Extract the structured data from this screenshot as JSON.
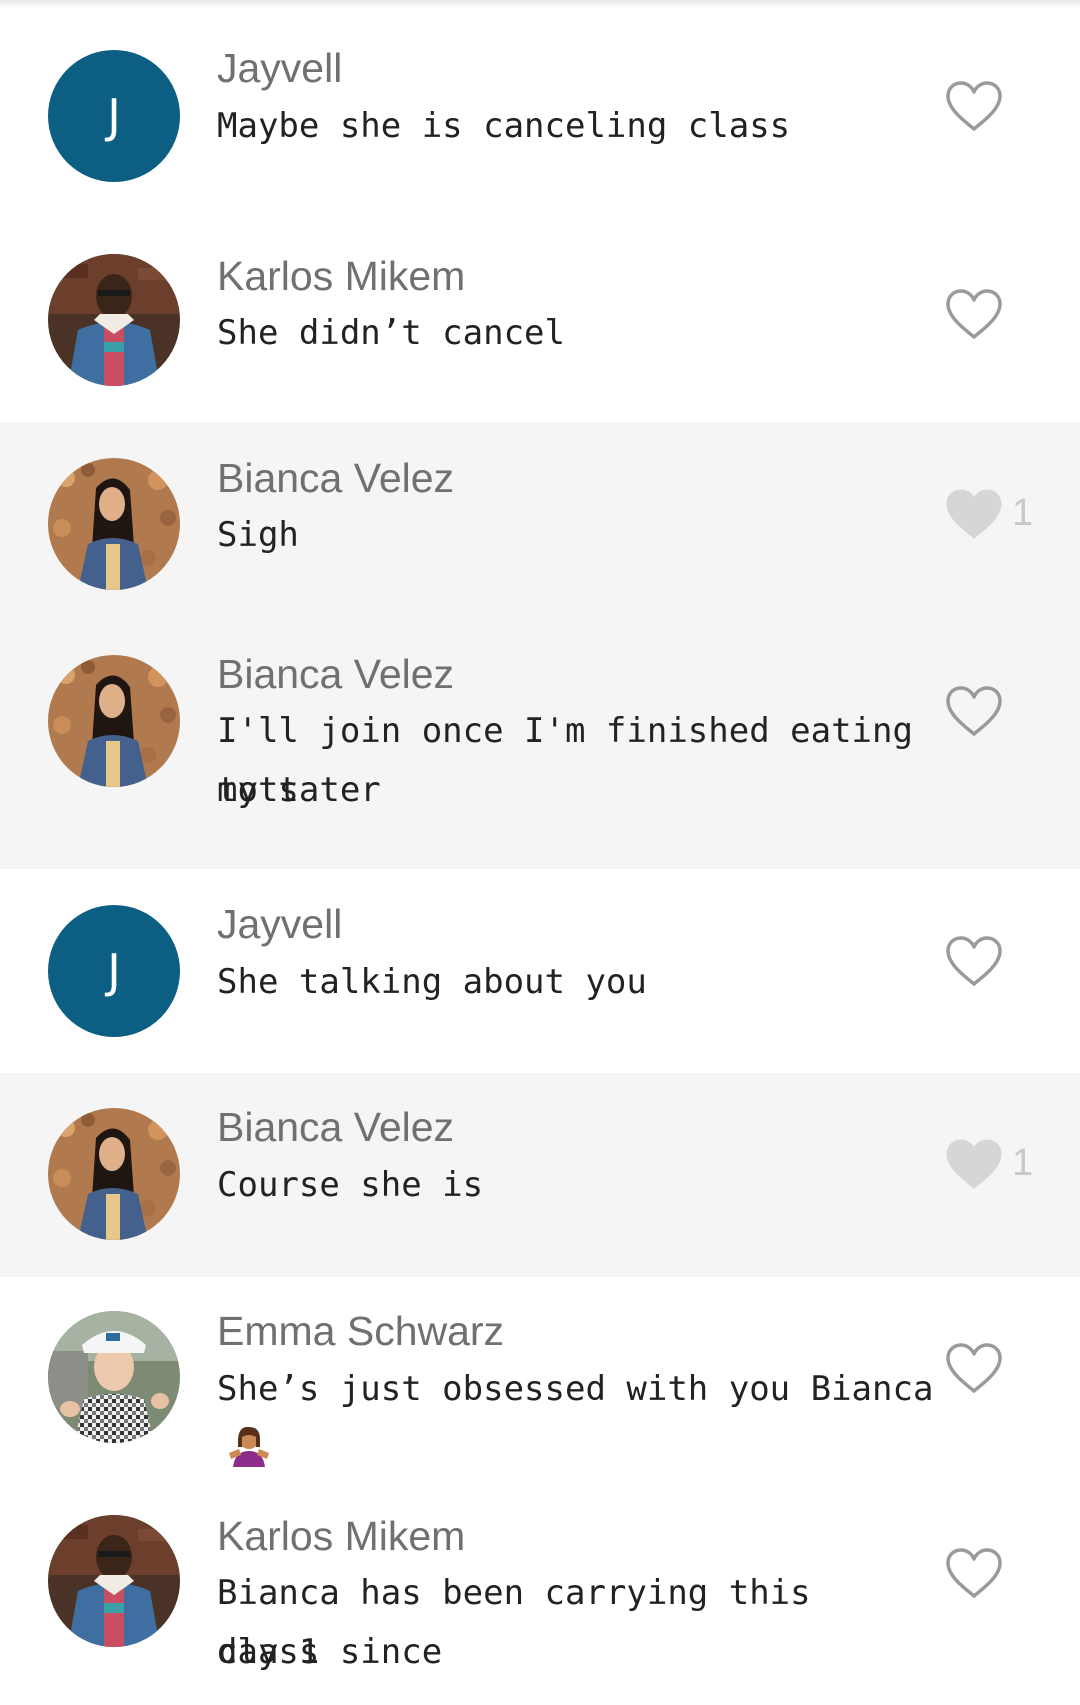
{
  "messages": [
    {
      "author": "Jayvell",
      "avatar_initial": "J",
      "text": "Maybe she is canceling class",
      "liked": false,
      "like_count": null
    },
    {
      "author": "Karlos Mikem",
      "text": "She didn’t cancel",
      "liked": false,
      "like_count": null
    },
    {
      "author": "Bianca Velez",
      "text": "Sigh",
      "liked": true,
      "like_count": "1"
    },
    {
      "author": "Bianca Velez",
      "text_line1": "I'll join once I'm finished eating my tater",
      "text_line2": "tots",
      "liked": false,
      "like_count": null
    },
    {
      "author": "Jayvell",
      "avatar_initial": "J",
      "text": "She talking about you",
      "liked": false,
      "like_count": null
    },
    {
      "author": "Bianca Velez",
      "text": "Course she is",
      "liked": true,
      "like_count": "1"
    },
    {
      "author": "Emma Schwarz",
      "text": "She’s just obsessed with you Bianca",
      "emoji": "person-shrugging-emoji",
      "liked": false,
      "like_count": null
    },
    {
      "author": "Karlos Mikem",
      "text_line1": "Bianca has been carrying this class since",
      "text_line2": "day 1",
      "liked": false,
      "like_count": null
    }
  ],
  "colors": {
    "avatar_initial_bg": "#0c5e82",
    "highlight_row_bg": "#f5f5f5",
    "author_text": "#707070",
    "message_text": "#222222",
    "heart_outline": "#9a9a9a",
    "heart_filled": "#d6d6d6"
  },
  "icons": {
    "like_outline": "heart-outline-icon",
    "like_filled": "heart-filled-icon"
  }
}
